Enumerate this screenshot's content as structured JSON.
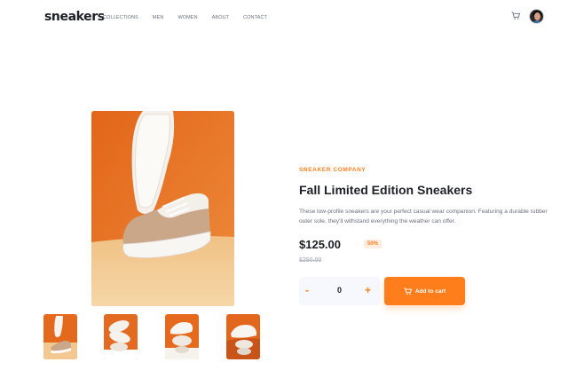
{
  "header": {
    "logo": "sneakers",
    "nav": [
      "COLLECTIONS",
      "MEN",
      "WOMEN",
      "ABOUT",
      "CONTACT"
    ]
  },
  "icons": {
    "cart": "cart-icon",
    "avatar": "avatar"
  },
  "gallery": {
    "thumbnails_count": 4
  },
  "product": {
    "company": "SNEAKER COMPANY",
    "title": "Fall Limited Edition Sneakers",
    "description": "These low-profile sneakers are your perfect casual wear companion. Featuring a durable rubber outer sole, they'll withstand everything the weather can offer.",
    "price": "$125.00",
    "discount": "50%",
    "old_price": "$250.00"
  },
  "cart": {
    "minus": "-",
    "quantity": "0",
    "plus": "+",
    "add_label": "Add to cart"
  },
  "colors": {
    "accent": "#ff7e1b",
    "photo_bg": "#e8701e",
    "floor": "#f2c98f"
  }
}
